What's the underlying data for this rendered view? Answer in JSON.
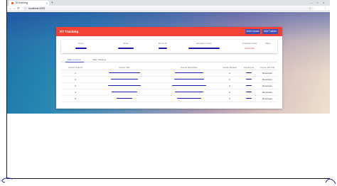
{
  "browser": {
    "tab_title": "TrtTracking",
    "tab_close": "×",
    "new_tab": "+",
    "url": "localhost:4200",
    "window_controls": [
      "–",
      "□",
      "×"
    ],
    "nav": {
      "back": "←",
      "forward": "→",
      "reload": "⟳"
    },
    "lock_icon": "ⓘ",
    "star_icon": "☆",
    "menu_icon": "⋮"
  },
  "app": {
    "title": "RT Tracking",
    "buttons": {
      "add_course": "Add Course",
      "add_trainee": "Add Trainee"
    }
  },
  "info": {
    "headers": [
      "Name",
      "Email",
      "Phone No",
      "Education Levels",
      "Graduation Date",
      "Status"
    ],
    "status_value": "Unverified"
  },
  "tabs": [
    {
      "label": "Take Courses",
      "active": true
    },
    {
      "label": "Take Trainings",
      "active": false
    }
  ],
  "table": {
    "headers": [
      "Course Code Id",
      "Course Title",
      "Course Description",
      "Course Duration",
      "Course Fee",
      "Course Job Title"
    ],
    "rows": [
      {
        "id": "1",
        "duration": "2",
        "job": "Developer"
      },
      {
        "id": "2",
        "duration": "3",
        "job": "Developer"
      },
      {
        "id": "3",
        "duration": "4",
        "job": "Developer"
      },
      {
        "id": "4",
        "duration": "2",
        "job": "Developer"
      },
      {
        "id": "5",
        "duration": "3",
        "job": "Developer"
      }
    ]
  },
  "colors": {
    "appbar": "#f44336",
    "primary": "#3f51b5",
    "redaction": "#1b1ba8",
    "status": "#e53935"
  }
}
